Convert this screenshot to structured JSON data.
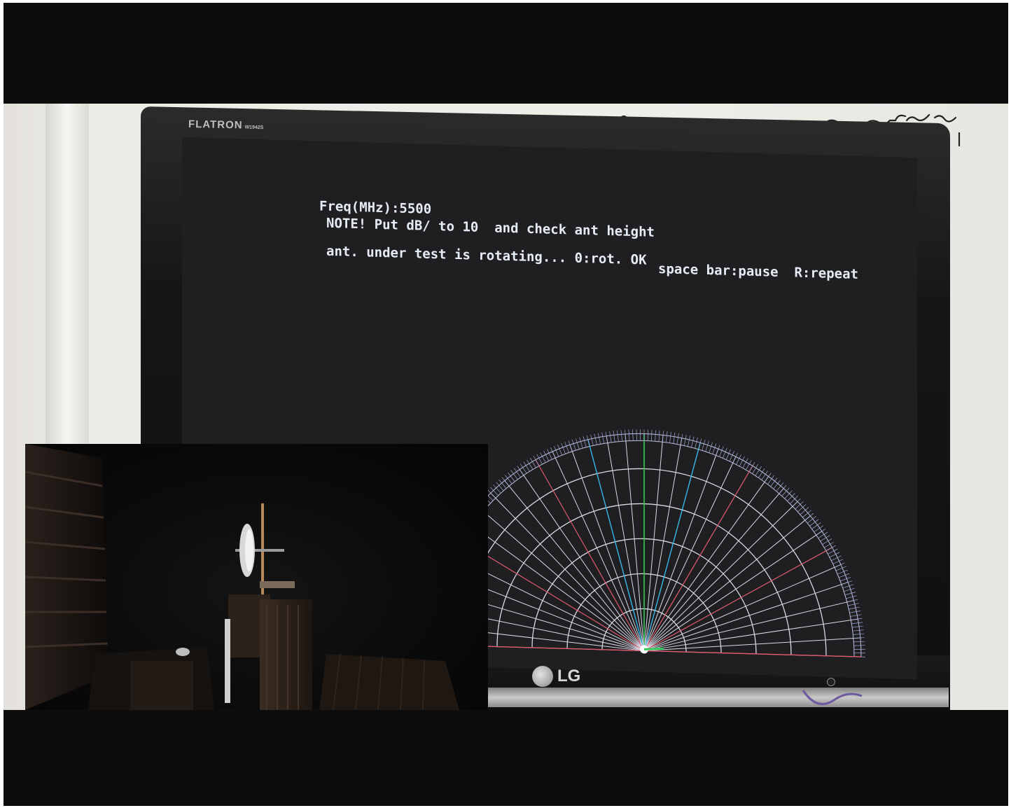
{
  "monitor": {
    "brand_top": "FLATRON",
    "brand_model": "W1942S",
    "brand_bottom": "LG"
  },
  "screen": {
    "line1": "Freq(MHz):5500",
    "line2": "NOTE! Put dB/ to 10  and check ant height",
    "line3": "ant. under test is rotating... 0:rot. OK",
    "line3b": "space bar:pause  R:repeat"
  },
  "polar_plot": {
    "type": "polar-grid",
    "grid_color": "#d9d9e6",
    "accent_colors": [
      "#37b7e6",
      "#32c85a",
      "#e05a6e",
      "#c8a0ff"
    ]
  },
  "inset_video": {
    "subject": "antenna on rotating mast in anechoic chamber"
  }
}
